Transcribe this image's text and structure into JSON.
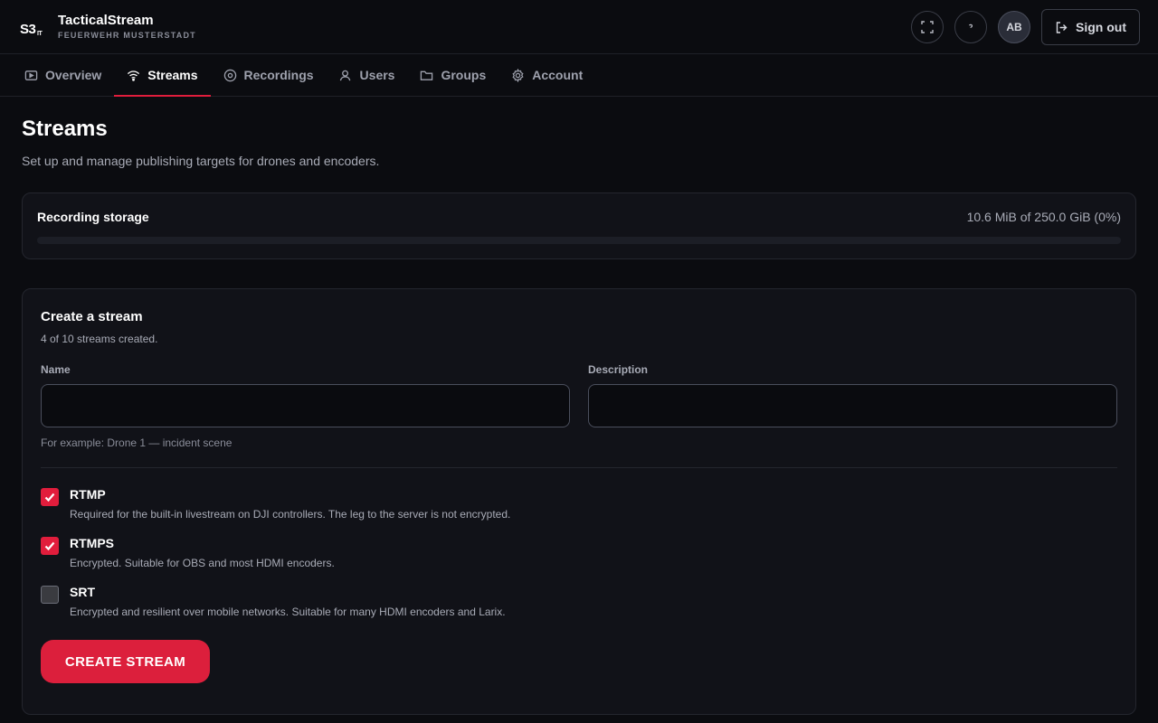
{
  "brand": {
    "logo_main": "S3",
    "logo_sub": "IT",
    "title": "TacticalStream",
    "subtitle": "FEUERWEHR MUSTERSTADT"
  },
  "header": {
    "avatar_initials": "AB",
    "signout_label": "Sign out"
  },
  "tabs": [
    {
      "label": "Overview",
      "icon": "play-icon"
    },
    {
      "label": "Streams",
      "icon": "wifi-icon",
      "active": true
    },
    {
      "label": "Recordings",
      "icon": "record-icon"
    },
    {
      "label": "Users",
      "icon": "user-icon"
    },
    {
      "label": "Groups",
      "icon": "folder-icon"
    },
    {
      "label": "Account",
      "icon": "gear-icon"
    }
  ],
  "page": {
    "title": "Streams",
    "description": "Set up and manage publishing targets for drones and encoders."
  },
  "storage": {
    "label": "Recording storage",
    "value": "10.6 MiB of 250.0 GiB (0%)",
    "percent": 0
  },
  "create": {
    "title": "Create a stream",
    "count": "4 of 10 streams created.",
    "name_label": "Name",
    "name_value": "",
    "description_label": "Description",
    "description_value": "",
    "hint": "For example: Drone 1 — incident scene",
    "options": [
      {
        "title": "RTMP",
        "desc": "Required for the built-in livestream on DJI controllers. The leg to the server is not encrypted.",
        "checked": true
      },
      {
        "title": "RTMPS",
        "desc": "Encrypted. Suitable for OBS and most HDMI encoders.",
        "checked": true
      },
      {
        "title": "SRT",
        "desc": "Encrypted and resilient over mobile networks. Suitable for many HDMI encoders and Larix.",
        "checked": false
      }
    ],
    "submit_label": "CREATE STREAM"
  },
  "colors": {
    "accent": "#e11d3c",
    "background": "#0b0c10",
    "card": "#111218"
  }
}
